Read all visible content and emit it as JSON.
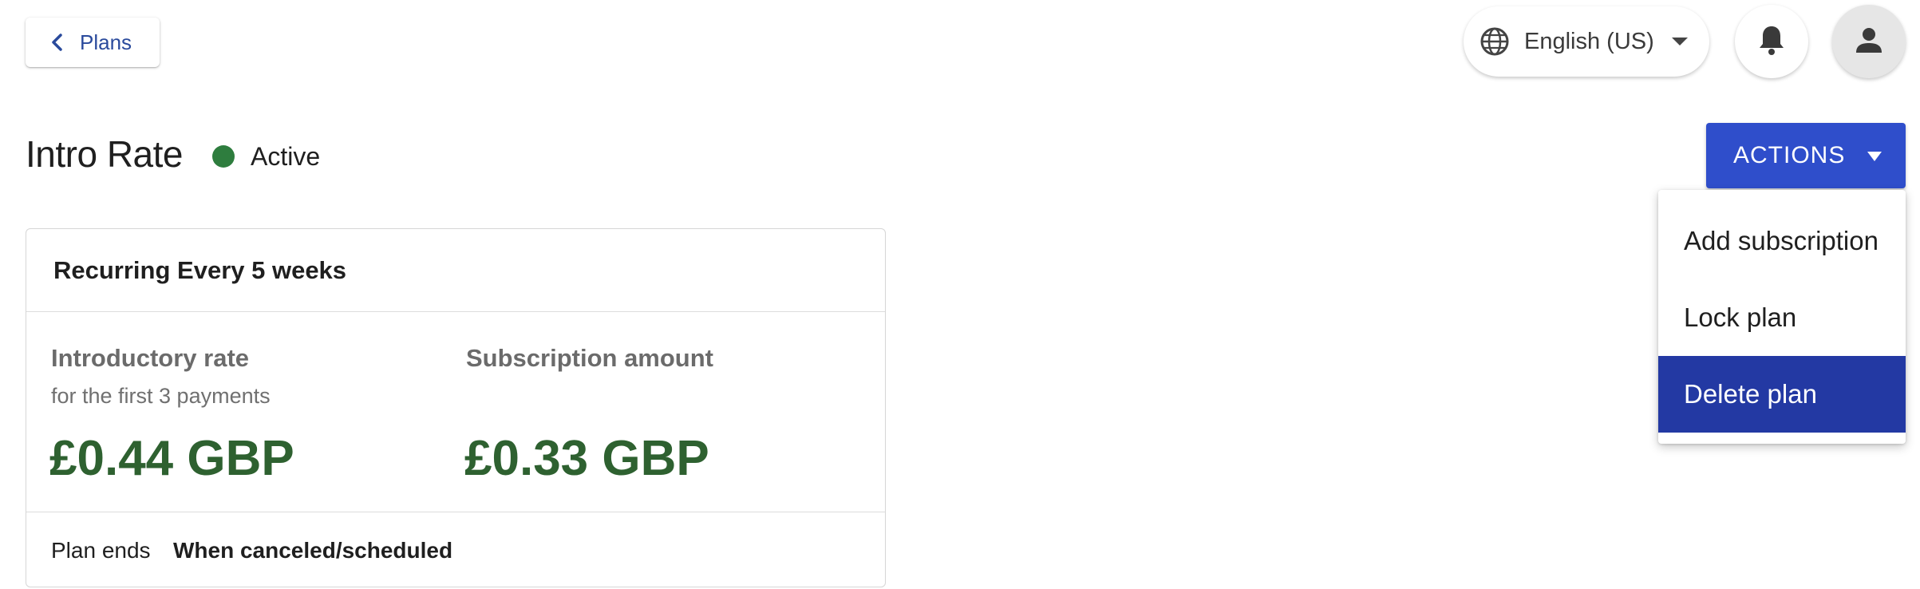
{
  "header": {
    "back_label": "Plans",
    "language": "English (US)",
    "icons": {
      "back": "chevron-left-icon",
      "language": "globe-icon",
      "language_caret": "caret-down-icon",
      "notifications": "bell-icon",
      "account": "person-icon"
    }
  },
  "plan": {
    "title": "Intro Rate",
    "status": "Active",
    "status_color": "#2e7d3e"
  },
  "actions": {
    "button_label": "ACTIONS",
    "button_color": "#2f4ecb",
    "menu": [
      {
        "label": "Add subscription",
        "selected": false
      },
      {
        "label": "Lock plan",
        "selected": false
      },
      {
        "label": "Delete plan",
        "selected": true
      }
    ],
    "selected_color": "#2339a3"
  },
  "card": {
    "recurrence": "Recurring Every 5 weeks",
    "intro": {
      "label": "Introductory rate",
      "sub": "for the first 3 payments",
      "amount": "£0.44 GBP"
    },
    "subscription": {
      "label": "Subscription amount",
      "amount": "£0.33 GBP"
    },
    "amount_color": "#2e6130",
    "ends": {
      "label": "Plan ends",
      "value": "When canceled/scheduled"
    }
  }
}
